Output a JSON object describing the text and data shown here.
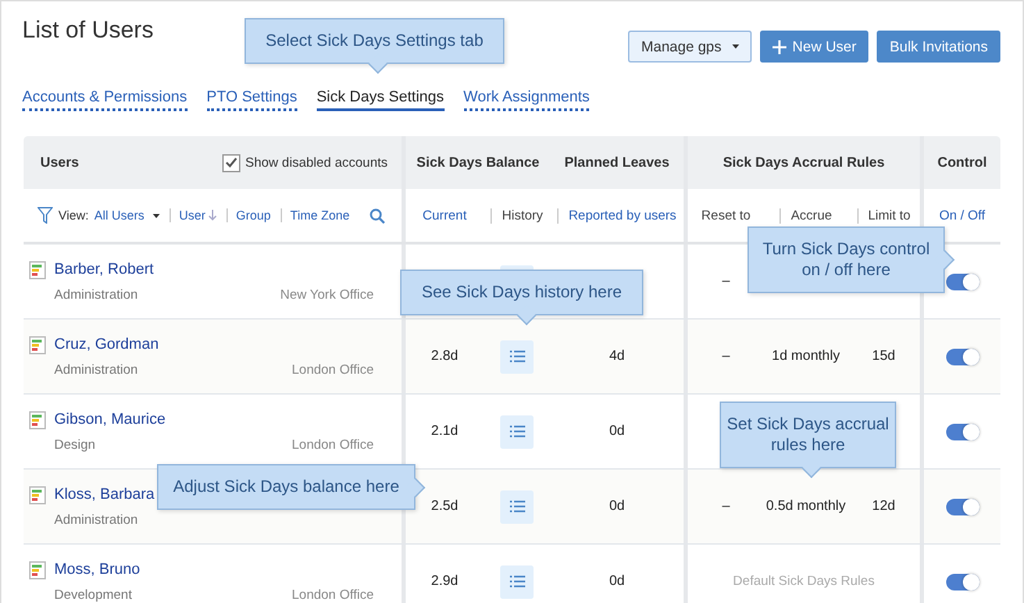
{
  "page": {
    "title": "List of Users"
  },
  "buttons": [
    {
      "label": "Manage gps",
      "kind": "dropdown"
    },
    {
      "label": "New User",
      "kind": "add"
    },
    {
      "label": "Bulk Invitations",
      "kind": "primary"
    }
  ],
  "tabs": [
    {
      "label": "Accounts & Permissions",
      "selected": false
    },
    {
      "label": "PTO Settings",
      "selected": false
    },
    {
      "label": "Sick Days Settings",
      "selected": true
    },
    {
      "label": "Work Assignments",
      "selected": false
    }
  ],
  "table": {
    "users_header": "Users",
    "show_disabled": {
      "label": "Show disabled accounts",
      "checked": true
    },
    "group_headers": [
      "Sick Days Balance",
      "Planned Leaves",
      "Sick Days Accrual Rules",
      "Control"
    ],
    "filter": {
      "view_label": "View:",
      "view_value": "All Users",
      "sorts": [
        "User",
        "Group",
        "Time Zone"
      ]
    },
    "subheaders": [
      "Current",
      "History",
      "Reported by users",
      "Reset to",
      "Accrue",
      "Limit to",
      "On / Off"
    ],
    "rows": [
      {
        "name": "Barber, Robert",
        "department": "Administration",
        "office": "New York Office",
        "rules": {
          "kind": "custom",
          "reset": "–"
        },
        "on": true
      },
      {
        "name": "Cruz, Gordman",
        "department": "Administration",
        "office": "London Office",
        "balance": "2.8d",
        "planned": "4d",
        "rules": {
          "kind": "custom",
          "reset": "–",
          "accrue": "1d monthly",
          "limit": "15d"
        },
        "on": true
      },
      {
        "name": "Gibson, Maurice",
        "department": "Design",
        "office": "London Office",
        "balance": "2.1d",
        "planned": "0d",
        "on": true
      },
      {
        "name": "Kloss, Barbara",
        "department": "Administration",
        "balance": "2.5d",
        "planned": "0d",
        "rules": {
          "kind": "custom",
          "reset": "–",
          "accrue": "0.5d monthly",
          "limit": "12d"
        },
        "on": true
      },
      {
        "name": "Moss, Bruno",
        "department": "Development",
        "office": "London Office",
        "balance": "2.9d",
        "planned": "0d",
        "rules": {
          "kind": "default",
          "text": "Default Sick Days Rules"
        },
        "on": true
      }
    ]
  },
  "callouts": [
    "Select Sick Days Settings tab",
    "See Sick Days history here",
    "Turn Sick Days control on / off here",
    "Set Sick Days accrual rules here",
    "Adjust Sick Days balance here"
  ]
}
